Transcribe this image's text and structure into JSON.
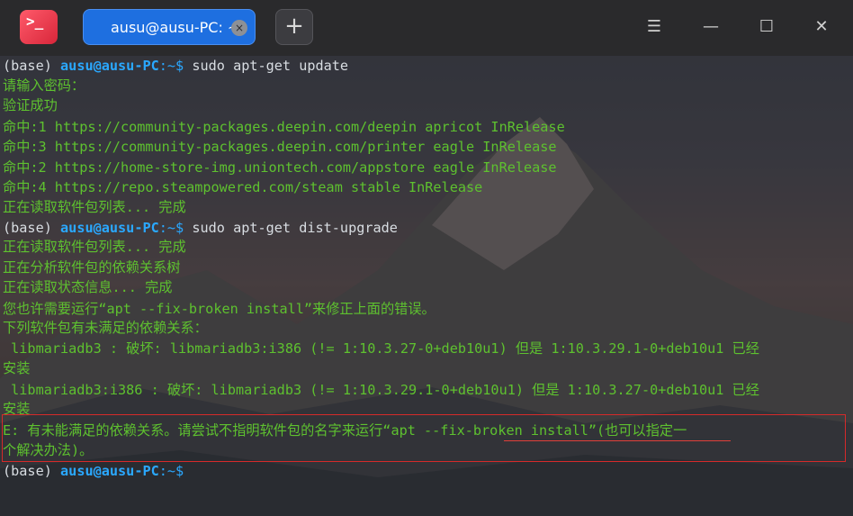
{
  "titlebar": {
    "app_icon_glyph": ">_",
    "tab_title": "ausu@ausu-PC: ~",
    "tab_close_glyph": "×",
    "new_tab_glyph": "+",
    "menu_glyph": "☰",
    "minimize_glyph": "—",
    "maximize_glyph": "☐",
    "close_glyph": "✕"
  },
  "terminal": {
    "prompt_base": "(base)",
    "prompt_user": "ausu@ausu-PC",
    "prompt_dir": ":~$",
    "cmd1": " sudo apt-get update",
    "l2": "请输入密码：",
    "l3": "验证成功",
    "l4": "命中:1 https://community-packages.deepin.com/deepin apricot InRelease",
    "l5": "命中:3 https://community-packages.deepin.com/printer eagle InRelease",
    "l6": "命中:2 https://home-store-img.uniontech.com/appstore eagle InRelease",
    "l7": "命中:4 https://repo.steampowered.com/steam stable InRelease",
    "l8": "正在读取软件包列表... 完成",
    "cmd2": " sudo apt-get dist-upgrade",
    "l10": "正在读取软件包列表... 完成",
    "l11": "正在分析软件包的依赖关系树",
    "l12": "正在读取状态信息... 完成",
    "l13": "您也许需要运行“apt --fix-broken install”来修正上面的错误。",
    "l14": "下列软件包有未满足的依赖关系：",
    "l15": " libmariadb3 : 破坏: libmariadb3:i386 (!= 1:10.3.27-0+deb10u1) 但是 1:10.3.29.1-0+deb10u1 已经",
    "l16": "安装",
    "l17": " libmariadb3:i386 : 破坏: libmariadb3 (!= 1:10.3.29.1-0+deb10u1) 但是 1:10.3.27-0+deb10u1 已经",
    "l18": "安装",
    "l19": "E: 有未能满足的依赖关系。请尝试不指明软件包的名字来运行“apt --fix-broken install”(也可以指定一",
    "l20": "个解决办法)。",
    "cmd3": ""
  },
  "colors": {
    "output_green": "#5ec12f",
    "prompt_blue": "#2aa8ff",
    "tab_blue": "#1e6fe0",
    "error_box_red": "#d62a2a"
  }
}
